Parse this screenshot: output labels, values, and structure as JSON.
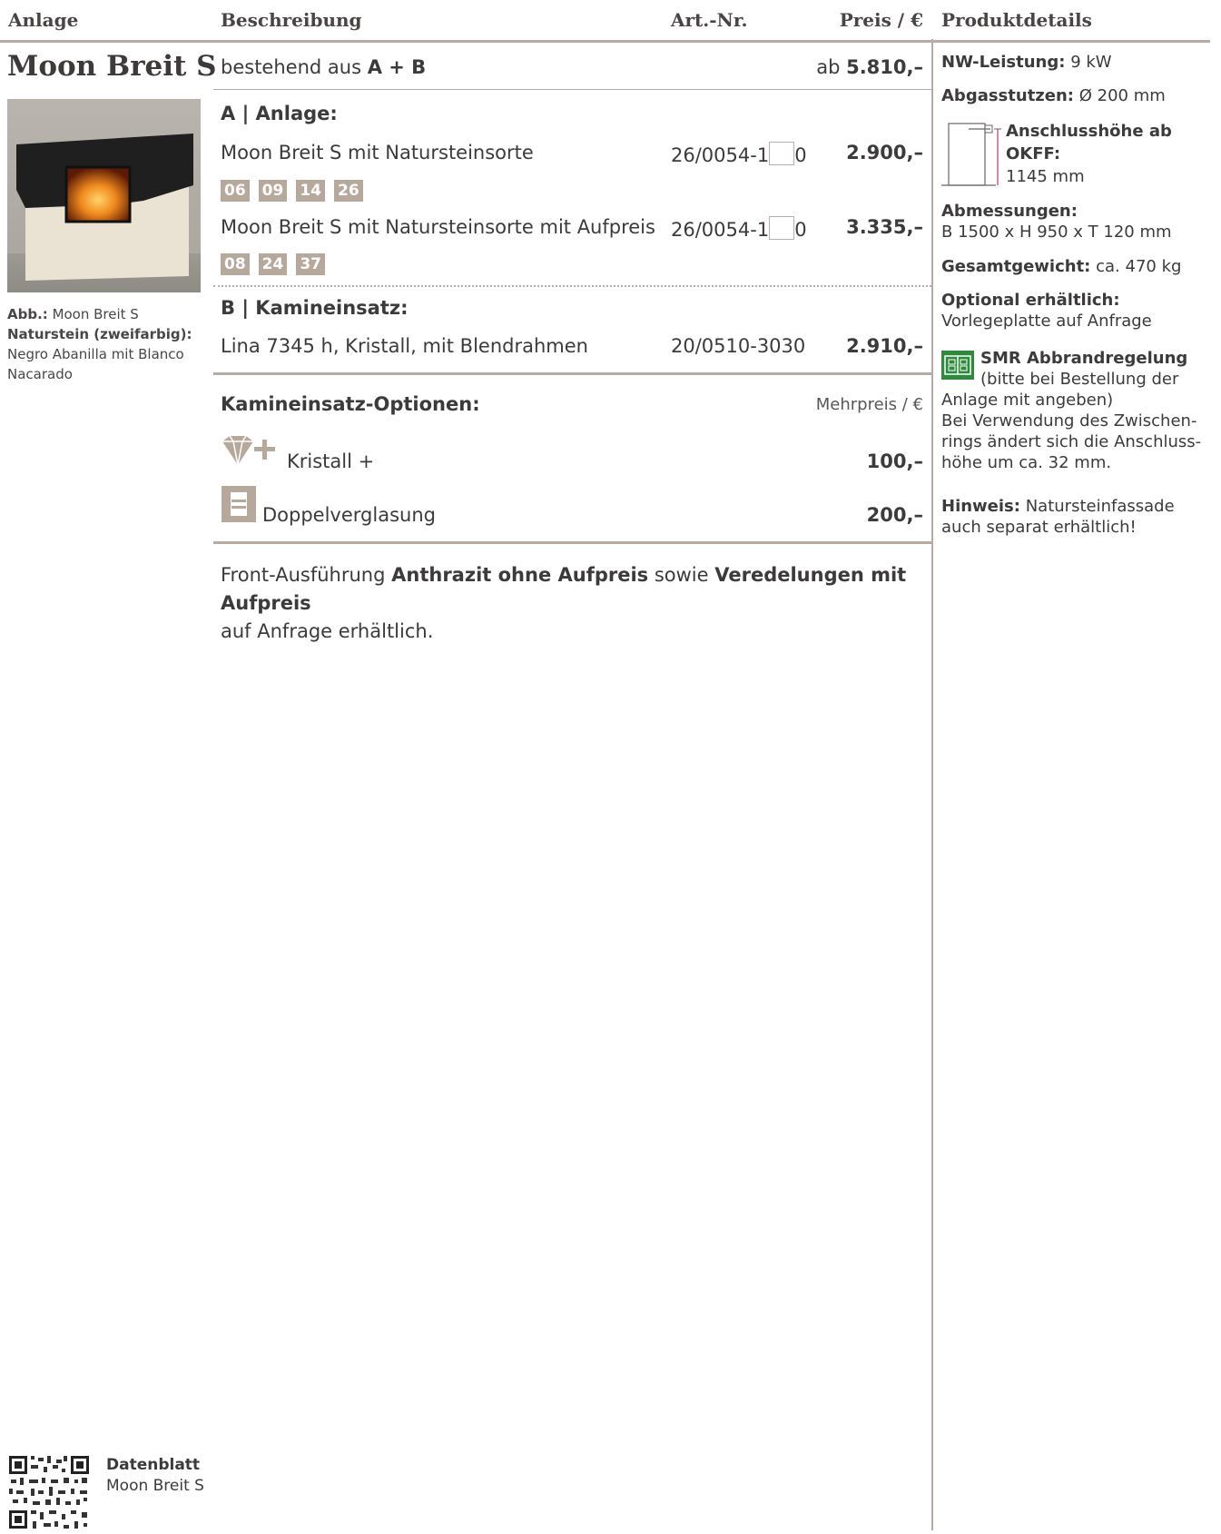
{
  "header": {
    "col_anlage": "Anlage",
    "col_beschreibung": "Beschreibung",
    "col_artnr": "Art.-Nr.",
    "col_preis": "Preis / €",
    "col_produktdetails": "Produktdetails"
  },
  "product": {
    "name": "Moon Breit S",
    "consists_prefix": "bestehend aus",
    "consists_parts": "A + B",
    "price_prefix": "ab",
    "price_total": "5.810,–"
  },
  "caption": {
    "abb_label": "Abb.:",
    "abb_value": "Moon Breit S",
    "stone_label": "Naturstein (zweifarbig):",
    "stone_value": "Negro Abanilla mit Blanco Nacarado"
  },
  "section_a": {
    "heading": "A | Anlage:",
    "items": [
      {
        "desc": "Moon Breit S mit Natursteinsorte",
        "art_pre": "26/0054-1",
        "art_post": "0",
        "price": "2.900,–",
        "swatches": [
          "06",
          "09",
          "14",
          "26"
        ]
      },
      {
        "desc": "Moon Breit S mit Natursteinsorte mit Aufpreis",
        "art_pre": "26/0054-1",
        "art_post": "0",
        "price": "3.335,–",
        "swatches": [
          "08",
          "24",
          "37"
        ]
      }
    ]
  },
  "section_b": {
    "heading": "B | Kamineinsatz:",
    "item": {
      "desc": "Lina 7345 h, Kristall, mit Blendrahmen",
      "art": "20/0510-3030",
      "price": "2.910,–"
    }
  },
  "options": {
    "heading": "Kamineinsatz-Optionen:",
    "price_header": "Mehrpreis / €",
    "items": [
      {
        "icon": "diamond-plus-icon",
        "label": "Kristall +",
        "price": "100,–"
      },
      {
        "icon": "double-glazing-icon",
        "label": "Doppelverglasung",
        "price": "200,–"
      }
    ]
  },
  "footnote": {
    "p1": "Front-Ausführung ",
    "b1": "Anthrazit ohne Aufpreis",
    "p2": " sowie ",
    "b2": "Veredelungen mit Aufpreis",
    "p3": "auf Anfrage erhältlich."
  },
  "details": {
    "nw_label": "NW-Leistung:",
    "nw_value": "9 kW",
    "abgas_label": "Abgasstutzen:",
    "abgas_value": "Ø 200 mm",
    "anschluss_label": "Anschlusshöhe ab OKFF:",
    "anschluss_value": "1145 mm",
    "abm_label": "Abmessungen:",
    "abm_value": "B 1500 x H 950 x T 120 mm",
    "gewicht_label": "Gesamtgewicht:",
    "gewicht_value": "ca. 470 kg",
    "optional_label": "Optional erhältlich:",
    "optional_value": "Vorlegeplatte auf Anfrage",
    "smr_label": "SMR Abbrandregelung",
    "smr_line1": "(bitte bei Bestellung der",
    "smr_line2": "Anlage mit angeben)",
    "smr_line3": "Bei Verwendung des Zwischen-",
    "smr_line4": "rings ändert sich die Anschluss-",
    "smr_line5": "höhe um ca. 32 mm.",
    "hinweis_label": "Hinweis:",
    "hinweis_value": "Natursteinfassade auch separat erhältlich!"
  },
  "datasheet": {
    "title": "Datenblatt",
    "subtitle": "Moon Breit S"
  },
  "colors": {
    "rule": "#b7aca3",
    "swatch": "#b7a89c",
    "smr_green": "#2e8b3d"
  }
}
